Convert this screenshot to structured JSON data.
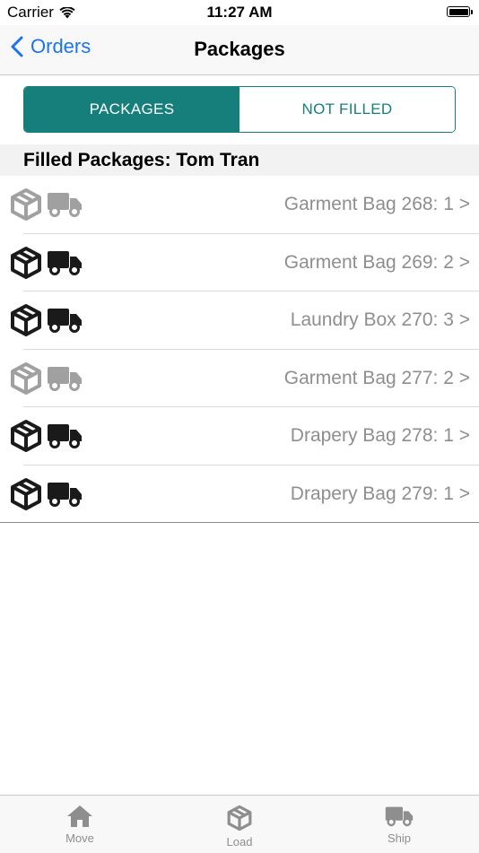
{
  "status_bar": {
    "carrier": "Carrier",
    "time": "11:27 AM",
    "wifi_icon": "wifi-icon",
    "battery_icon": "battery-icon"
  },
  "nav": {
    "back_label": "Orders",
    "title": "Packages"
  },
  "segments": [
    {
      "label": "PACKAGES",
      "selected": true
    },
    {
      "label": "NOT FILLED",
      "selected": false
    }
  ],
  "section_title": "Filled Packages: Tom Tran",
  "packages": [
    {
      "label": "Garment Bag 268: 1 >",
      "status": "inactive",
      "icons": [
        "box-icon",
        "truck-icon"
      ]
    },
    {
      "label": "Garment Bag 269: 2 >",
      "status": "active",
      "icons": [
        "box-icon",
        "truck-icon"
      ]
    },
    {
      "label": "Laundry Box 270: 3 >",
      "status": "active",
      "icons": [
        "box-icon",
        "truck-icon"
      ]
    },
    {
      "label": "Garment Bag 277: 2 >",
      "status": "inactive",
      "icons": [
        "box-icon",
        "truck-icon"
      ]
    },
    {
      "label": "Drapery Bag 278: 1 >",
      "status": "active",
      "icons": [
        "box-icon",
        "truck-icon"
      ]
    },
    {
      "label": "Drapery Bag 279: 1 >",
      "status": "active",
      "icons": [
        "box-icon",
        "truck-icon"
      ]
    }
  ],
  "tabs": [
    {
      "label": "Move",
      "icon": "home-icon"
    },
    {
      "label": "Load",
      "icon": "box-icon"
    },
    {
      "label": "Ship",
      "icon": "truck-icon"
    }
  ],
  "colors": {
    "accent": "#167f7c",
    "link": "#1a74f2",
    "icon_active": "#1a1a1a",
    "icon_inactive": "#a0a0a0",
    "label_gray": "#8e8e8e"
  }
}
